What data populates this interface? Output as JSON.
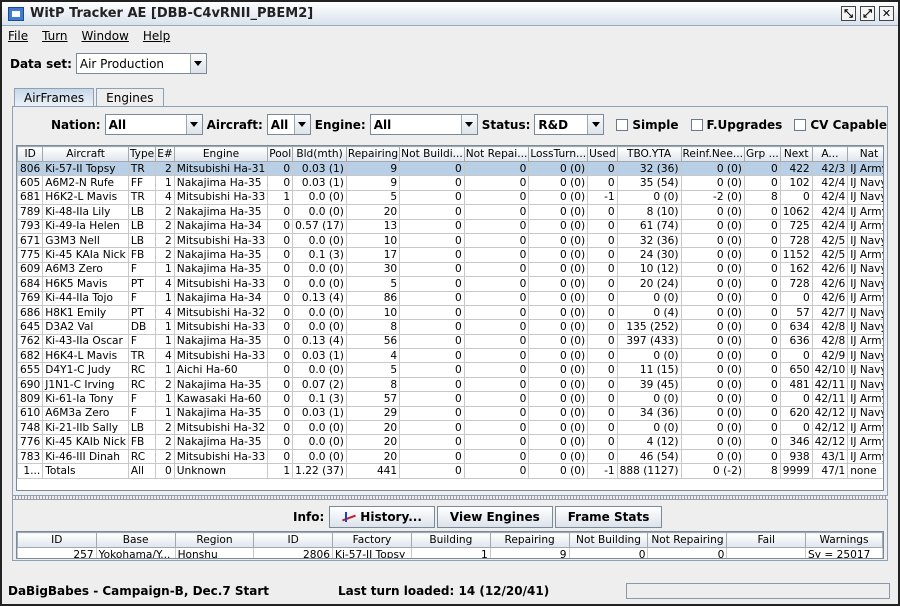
{
  "window": {
    "title": "WitP Tracker AE [DBB-C4vRNII_PBEM2]"
  },
  "menu": [
    "File",
    "Turn",
    "Window",
    "Help"
  ],
  "dataset": {
    "label": "Data set:",
    "value": "Air Production"
  },
  "tabs": [
    "AirFrames",
    "Engines"
  ],
  "filters": {
    "nation_label": "Nation:",
    "nation": "All",
    "aircraft_label": "Aircraft:",
    "aircraft": "All",
    "engine_label": "Engine:",
    "engine": "All",
    "status_label": "Status:",
    "status": "R&D",
    "simple": "Simple",
    "fupgrades": "F.Upgrades",
    "cvcapable": "CV Capable"
  },
  "table": {
    "headers": [
      "ID",
      "Aircraft",
      "Type",
      "E#",
      "Engine",
      "Pool",
      "Bld(mth)",
      "Repairing",
      "Not Buildi...",
      "Not Repai...",
      "LossTurn...",
      "Used",
      "TBO.YTA",
      "Reinf.Nee...",
      "Grp ...",
      "Next",
      "A...",
      "Nat"
    ],
    "rows": [
      [
        "806",
        "Ki-57-II Topsy",
        "TR",
        "2",
        "Mitsubishi Ha-31",
        "0",
        "0.03 (1)",
        "9",
        "0",
        "0",
        "0 (0)",
        "0",
        "32 (36)",
        "0 (0)",
        "0",
        "422",
        "42/3",
        "IJ Army"
      ],
      [
        "605",
        "A6M2-N Rufe",
        "FF",
        "1",
        "Nakajima Ha-35",
        "0",
        "0.03 (1)",
        "9",
        "0",
        "0",
        "0 (0)",
        "0",
        "35 (54)",
        "0 (0)",
        "0",
        "102",
        "42/4",
        "IJ Navy"
      ],
      [
        "681",
        "H6K2-L Mavis",
        "TR",
        "4",
        "Mitsubishi Ha-33",
        "1",
        "0.0 (0)",
        "5",
        "0",
        "0",
        "0 (0)",
        "-1",
        "0 (0)",
        "-2 (0)",
        "8",
        "0",
        "42/4",
        "IJ Navy"
      ],
      [
        "789",
        "Ki-48-IIa Lily",
        "LB",
        "2",
        "Nakajima Ha-35",
        "0",
        "0.0 (0)",
        "20",
        "0",
        "0",
        "0 (0)",
        "0",
        "8 (10)",
        "0 (0)",
        "0",
        "1062",
        "42/4",
        "IJ Army"
      ],
      [
        "793",
        "Ki-49-Ia Helen",
        "LB",
        "2",
        "Nakajima Ha-34",
        "0",
        "0.57 (17)",
        "13",
        "0",
        "0",
        "0 (0)",
        "0",
        "61 (74)",
        "0 (0)",
        "0",
        "725",
        "42/4",
        "IJ Army"
      ],
      [
        "671",
        "G3M3 Nell",
        "LB",
        "2",
        "Mitsubishi Ha-33",
        "0",
        "0.0 (0)",
        "10",
        "0",
        "0",
        "0 (0)",
        "0",
        "32 (36)",
        "0 (0)",
        "0",
        "728",
        "42/5",
        "IJ Navy"
      ],
      [
        "775",
        "Ki-45 KAIa Nick",
        "FB",
        "2",
        "Nakajima Ha-35",
        "0",
        "0.1 (3)",
        "17",
        "0",
        "0",
        "0 (0)",
        "0",
        "24 (30)",
        "0 (0)",
        "0",
        "1152",
        "42/5",
        "IJ Army"
      ],
      [
        "609",
        "A6M3 Zero",
        "F",
        "1",
        "Nakajima Ha-35",
        "0",
        "0.0 (0)",
        "30",
        "0",
        "0",
        "0 (0)",
        "0",
        "10 (12)",
        "0 (0)",
        "0",
        "162",
        "42/6",
        "IJ Navy"
      ],
      [
        "684",
        "H6K5 Mavis",
        "PT",
        "4",
        "Mitsubishi Ha-33",
        "0",
        "0.0 (0)",
        "5",
        "0",
        "0",
        "0 (0)",
        "0",
        "20 (24)",
        "0 (0)",
        "0",
        "728",
        "42/6",
        "IJ Navy"
      ],
      [
        "769",
        "Ki-44-IIa Tojo",
        "F",
        "1",
        "Nakajima Ha-34",
        "0",
        "0.13 (4)",
        "86",
        "0",
        "0",
        "0 (0)",
        "0",
        "0 (0)",
        "0 (0)",
        "0",
        "0",
        "42/6",
        "IJ Army"
      ],
      [
        "686",
        "H8K1 Emily",
        "PT",
        "4",
        "Mitsubishi Ha-32",
        "0",
        "0.0 (0)",
        "10",
        "0",
        "0",
        "0 (0)",
        "0",
        "0 (4)",
        "0 (0)",
        "0",
        "57",
        "42/7",
        "IJ Navy"
      ],
      [
        "645",
        "D3A2 Val",
        "DB",
        "1",
        "Mitsubishi Ha-33",
        "0",
        "0.0 (0)",
        "8",
        "0",
        "0",
        "0 (0)",
        "0",
        "135 (252)",
        "0 (0)",
        "0",
        "634",
        "42/8",
        "IJ Navy"
      ],
      [
        "762",
        "Ki-43-IIa Oscar",
        "F",
        "1",
        "Nakajima Ha-35",
        "0",
        "0.13 (4)",
        "56",
        "0",
        "0",
        "0 (0)",
        "0",
        "397 (433)",
        "0 (0)",
        "0",
        "636",
        "42/8",
        "IJ Army"
      ],
      [
        "682",
        "H6K4-L Mavis",
        "TR",
        "4",
        "Mitsubishi Ha-33",
        "0",
        "0.03 (1)",
        "4",
        "0",
        "0",
        "0 (0)",
        "0",
        "0 (0)",
        "0 (0)",
        "0",
        "0",
        "42/9",
        "IJ Navy"
      ],
      [
        "655",
        "D4Y1-C Judy",
        "RC",
        "1",
        "Aichi Ha-60",
        "0",
        "0.0 (0)",
        "5",
        "0",
        "0",
        "0 (0)",
        "0",
        "11 (15)",
        "0 (0)",
        "0",
        "650",
        "42/10",
        "IJ Navy"
      ],
      [
        "690",
        "J1N1-C Irving",
        "RC",
        "2",
        "Nakajima Ha-35",
        "0",
        "0.07 (2)",
        "8",
        "0",
        "0",
        "0 (0)",
        "0",
        "39 (45)",
        "0 (0)",
        "0",
        "481",
        "42/11",
        "IJ Navy"
      ],
      [
        "809",
        "Ki-61-Ia Tony",
        "F",
        "1",
        "Kawasaki Ha-60",
        "0",
        "0.1 (3)",
        "57",
        "0",
        "0",
        "0 (0)",
        "0",
        "0 (0)",
        "0 (0)",
        "0",
        "0",
        "42/11",
        "IJ Army"
      ],
      [
        "610",
        "A6M3a Zero",
        "F",
        "1",
        "Nakajima Ha-35",
        "0",
        "0.03 (1)",
        "29",
        "0",
        "0",
        "0 (0)",
        "0",
        "34 (36)",
        "0 (0)",
        "0",
        "620",
        "42/12",
        "IJ Navy"
      ],
      [
        "748",
        "Ki-21-IIb Sally",
        "LB",
        "2",
        "Mitsubishi Ha-32",
        "0",
        "0.0 (0)",
        "20",
        "0",
        "0",
        "0 (0)",
        "0",
        "0 (0)",
        "0 (0)",
        "0",
        "0",
        "42/12",
        "IJ Army"
      ],
      [
        "776",
        "Ki-45 KAIb Nick",
        "FB",
        "2",
        "Nakajima Ha-35",
        "0",
        "0.0 (0)",
        "20",
        "0",
        "0",
        "0 (0)",
        "0",
        "4 (12)",
        "0 (0)",
        "0",
        "346",
        "42/12",
        "IJ Army"
      ],
      [
        "783",
        "Ki-46-III Dinah",
        "RC",
        "2",
        "Mitsubishi Ha-33",
        "0",
        "0.0 (0)",
        "20",
        "0",
        "0",
        "0 (0)",
        "0",
        "46 (54)",
        "0 (0)",
        "0",
        "938",
        "43/1",
        "IJ Army"
      ],
      [
        "1...",
        "Totals",
        "All",
        "0",
        "Unknown",
        "1",
        "1.22 (37)",
        "441",
        "0",
        "0",
        "0 (0)",
        "-1",
        "888 (1127)",
        "0 (-2)",
        "8",
        "9999",
        "47/1",
        "none"
      ]
    ]
  },
  "info": {
    "label": "Info:",
    "history": "History...",
    "view_engines": "View Engines",
    "frame_stats": "Frame Stats",
    "headers": [
      "ID",
      "Base",
      "Region",
      "ID",
      "Factory",
      "Building",
      "Repairing",
      "Not Building",
      "Not Repairing",
      "Fail",
      "Warnings"
    ],
    "row": [
      "257",
      "Yokohama/Y...",
      "Honshu",
      "2806",
      "Ki-57-II Topsy",
      "1",
      "9",
      "0",
      "0",
      "",
      "Sy = 25017"
    ]
  },
  "status": {
    "left": "DaBigBabes - Campaign-B, Dec.7 Start",
    "mid": "Last turn loaded: 14 (12/20/41)"
  }
}
